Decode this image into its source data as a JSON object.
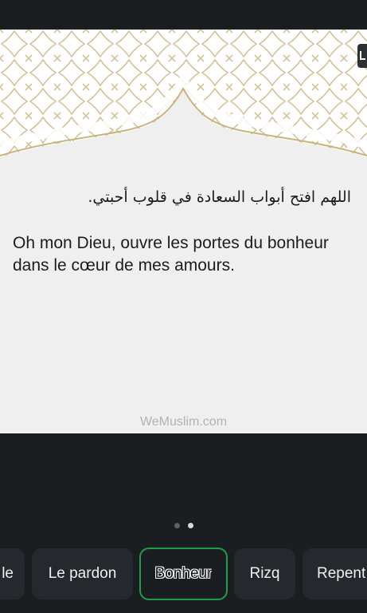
{
  "card": {
    "arabic_text": "اللهم افتح أبواب السعادة في قلوب أحبتي.",
    "french_text": "Oh mon Dieu, ouvre les portes du bonheur dans le cœur de mes amours.",
    "watermark": "WeMuslim.com"
  },
  "pager": {
    "count": 2,
    "active_index": 1
  },
  "categories": [
    {
      "label": "le",
      "selected": false
    },
    {
      "label": "Le pardon",
      "selected": false
    },
    {
      "label": "Bonheur",
      "selected": true
    },
    {
      "label": "Rizq",
      "selected": false
    },
    {
      "label": "Repent",
      "selected": false
    }
  ],
  "colors": {
    "background": "#1b1e21",
    "card": "#efefef",
    "pattern_gold": "#c9b27c",
    "selected_border": "#1f9d4d"
  }
}
